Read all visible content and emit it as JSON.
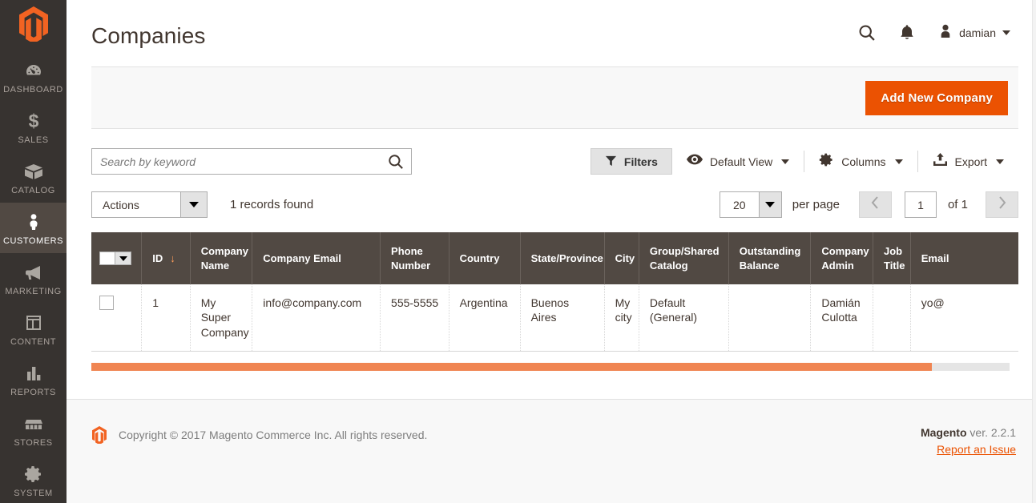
{
  "colors": {
    "accent": "#eb5202",
    "sidebar_bg": "#373330",
    "sidebar_active_bg": "#514943",
    "table_header_bg": "#514943",
    "scrollbar_thumb": "#f08552",
    "sort_marker": "#ff9d5a"
  },
  "sidebar": {
    "logo": "magento-logo",
    "items": [
      {
        "label": "Dashboard",
        "icon": "dashboard-icon",
        "active": false
      },
      {
        "label": "Sales",
        "icon": "dollar-icon",
        "active": false
      },
      {
        "label": "Catalog",
        "icon": "box-icon",
        "active": false
      },
      {
        "label": "Customers",
        "icon": "person-icon",
        "active": true
      },
      {
        "label": "Marketing",
        "icon": "megaphone-icon",
        "active": false
      },
      {
        "label": "Content",
        "icon": "layout-icon",
        "active": false
      },
      {
        "label": "Reports",
        "icon": "bar-chart-icon",
        "active": false
      },
      {
        "label": "Stores",
        "icon": "storefront-icon",
        "active": false
      },
      {
        "label": "System",
        "icon": "gear-icon",
        "active": false
      }
    ]
  },
  "header": {
    "title": "Companies",
    "search_icon": "search-icon",
    "notifications_icon": "bell-icon",
    "user_icon": "user-avatar-icon",
    "user_name": "damian"
  },
  "page_actions": {
    "add_new_company": "Add New Company"
  },
  "toolbar": {
    "search_value": "",
    "search_placeholder": "Search by keyword",
    "search_button_icon": "search-icon",
    "filters_label": "Filters",
    "filters_icon": "funnel-icon",
    "view_label": "Default View",
    "view_icon": "eye-icon",
    "columns_label": "Columns",
    "columns_icon": "gear-icon",
    "export_label": "Export",
    "export_icon": "export-upload-icon"
  },
  "subtoolbar": {
    "actions_label": "Actions",
    "records_found": "1 records found",
    "per_page_value": "20",
    "per_page_label": "per page",
    "prev_icon": "chevron-left-icon",
    "next_icon": "chevron-right-icon",
    "current_page": "1",
    "of_pages": "of 1"
  },
  "grid": {
    "select_all_checkbox": "",
    "columns": [
      {
        "label": "ID",
        "sorted": true,
        "sort_marker": "↓"
      },
      {
        "label": "Company Name",
        "sorted": false
      },
      {
        "label": "Company Email",
        "sorted": false
      },
      {
        "label": "Phone Number",
        "sorted": false
      },
      {
        "label": "Country",
        "sorted": false
      },
      {
        "label": "State/Province",
        "sorted": false
      },
      {
        "label": "City",
        "sorted": false
      },
      {
        "label": "Group/Shared Catalog",
        "sorted": false
      },
      {
        "label": "Outstanding Balance",
        "sorted": false
      },
      {
        "label": "Company Admin",
        "sorted": false
      },
      {
        "label": "Job Title",
        "sorted": false
      },
      {
        "label": "Email",
        "sorted": false
      }
    ],
    "rows": [
      {
        "id": "1",
        "company_name": "My Super Company",
        "company_email": "info@company.com",
        "phone_number": "555-5555",
        "country": "Argentina",
        "state_province": "Buenos Aires",
        "city": "My city",
        "group_shared_catalog": "Default (General)",
        "outstanding_balance": "",
        "company_admin": "Damián Culotta",
        "job_title": "",
        "email": "yo@"
      }
    ]
  },
  "footer": {
    "logo": "magento-logo",
    "copyright": "Copyright © 2017 Magento Commerce Inc. All rights reserved.",
    "brand": "Magento",
    "version": " ver. 2.2.1",
    "report_link": "Report an Issue"
  }
}
